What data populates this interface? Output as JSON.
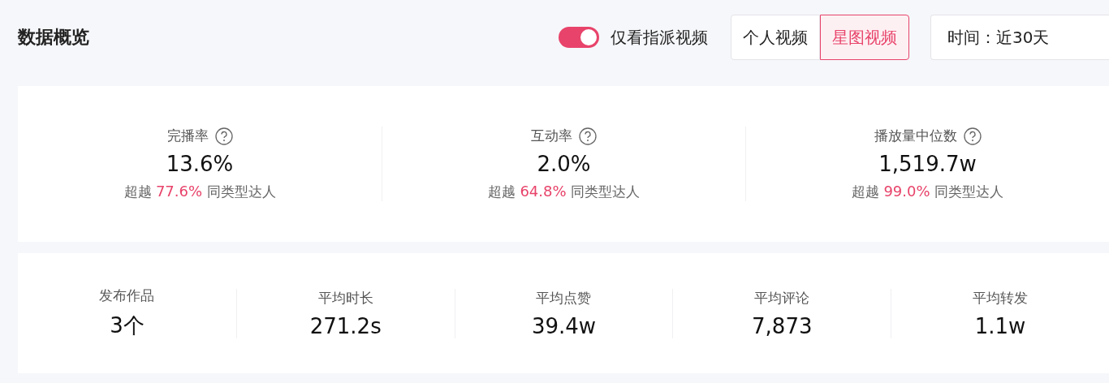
{
  "title": "数据概览",
  "filter_toggle": {
    "label": "仅看指派视频",
    "on": true
  },
  "video_tabs": [
    {
      "label": "个人视频",
      "selected": false
    },
    {
      "label": "星图视频",
      "selected": true
    }
  ],
  "time_select": {
    "value": "时间：近30天"
  },
  "main_metrics": [
    {
      "label": "完播率",
      "value": "13.6%",
      "compare_prefix": "超越",
      "compare_value": "77.6%",
      "compare_suffix": "同类型达人"
    },
    {
      "label": "互动率",
      "value": "2.0%",
      "compare_prefix": "超越",
      "compare_value": "64.8%",
      "compare_suffix": "同类型达人"
    },
    {
      "label": "播放量中位数",
      "value": "1,519.7w",
      "compare_prefix": "超越",
      "compare_value": "99.0%",
      "compare_suffix": "同类型达人"
    }
  ],
  "sub_metrics": [
    {
      "label": "发布作品",
      "value": "3个"
    },
    {
      "label": "平均时长",
      "value": "271.2s"
    },
    {
      "label": "平均点赞",
      "value": "39.4w"
    },
    {
      "label": "平均评论",
      "value": "7,873"
    },
    {
      "label": "平均转发",
      "value": "1.1w"
    }
  ]
}
